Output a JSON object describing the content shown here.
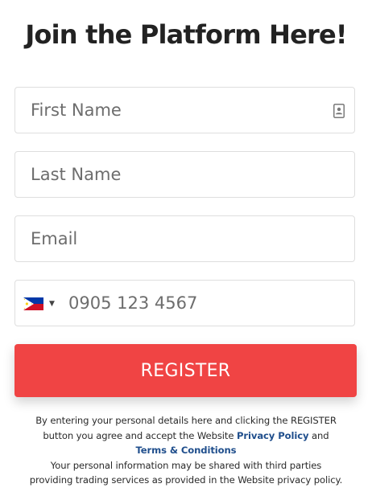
{
  "form": {
    "title": "Join the Platform Here!",
    "first_name_placeholder": "First Name",
    "last_name_placeholder": "Last Name",
    "email_placeholder": "Email",
    "phone_placeholder": "0905 123 4567",
    "phone_country_icon": "philippines-flag-icon",
    "contact_card_icon": "contact-card-icon",
    "register_label": "REGISTER"
  },
  "disclaimer": {
    "line1": "By entering your personal details here and clicking the REGISTER",
    "line2_pre": "button you agree and accept the Website",
    "privacy_link": "Privacy Policy",
    "line2_and": "and",
    "terms_link": "Terms & Conditions",
    "line4": "Your personal information may be shared with third parties",
    "line5": "providing trading services as provided in the Website privacy policy."
  },
  "colors": {
    "register_button": "#f04444",
    "link": "#1f4e8c",
    "title": "#222222",
    "border": "#dedede"
  }
}
